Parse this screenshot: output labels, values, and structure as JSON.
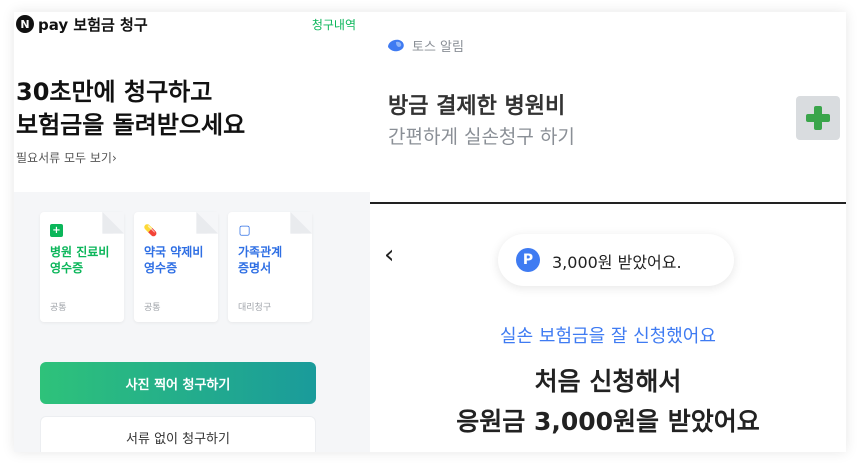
{
  "left": {
    "logo_letter": "N",
    "title": "pay 보험금 청구",
    "history_link": "청구내역",
    "headline_line1": "30초만에 청구하고",
    "headline_line2": "보험금을 돌려받으세요",
    "docs_link": "필요서류 모두 보기",
    "docs_chevron": "›",
    "cards": [
      {
        "icon": "+",
        "name_line1": "병원 진료비",
        "name_line2": "영수증",
        "tag": "공통",
        "color": "#0bb65a"
      },
      {
        "icon": "💊",
        "name_line1": "약국 약제비",
        "name_line2": "영수증",
        "tag": "공통",
        "color": "#2f6fe4"
      },
      {
        "icon": "▢",
        "name_line1": "가족관계",
        "name_line2": "증명서",
        "tag": "대리청구",
        "color": "#2f6fe4"
      }
    ],
    "primary_button": "사진 찍어 청구하기",
    "secondary_button": "서류 없이 청구하기"
  },
  "toss_notice": {
    "sender": "토스 알림",
    "title": "방금 결제한 병원비",
    "subtitle": "간편하게 실손청구 하기"
  },
  "result": {
    "back_glyph": "‹",
    "reward_icon": "P",
    "reward_text": "3,000원 받았어요.",
    "subtitle": "실손 보험금을 잘 신청했어요",
    "headline_line1": "처음 신청해서",
    "headline_line2": "응원금 3,000원을 받았어요"
  },
  "colors": {
    "accent_green": "#0bb65a",
    "toss_blue": "#3f7bf2",
    "plus_green": "#3aa54b"
  }
}
